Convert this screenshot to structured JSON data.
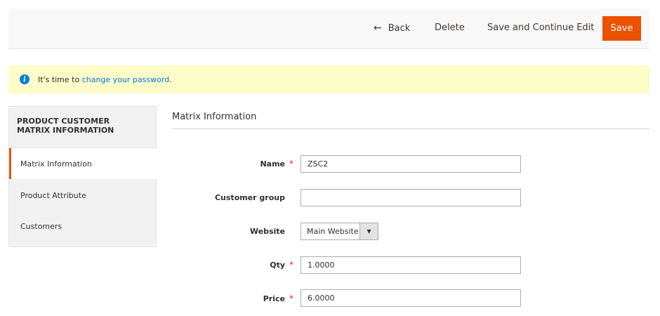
{
  "actions": {
    "back_arrow": "←",
    "back_label": "Back",
    "delete_label": "Delete",
    "save_continue_label": "Save and Continue Edit",
    "save_label": "Save"
  },
  "notice": {
    "icon": "info-icon",
    "text_before": "It's time to ",
    "link_text": "change your password",
    "text_after": "."
  },
  "sidebar": {
    "title": "PRODUCT CUSTOMER MATRIX INFORMATION",
    "items": [
      {
        "label": "Matrix Information",
        "active": true
      },
      {
        "label": "Product Attribute",
        "active": false
      },
      {
        "label": "Customers",
        "active": false
      }
    ]
  },
  "main": {
    "section_title": "Matrix Information",
    "fields": {
      "name": {
        "label": "Name",
        "value": "ZSC2",
        "required": true
      },
      "customer_group": {
        "label": "Customer group",
        "value": "",
        "required": false
      },
      "website": {
        "label": "Website",
        "value": "Main Website",
        "required": false
      },
      "qty": {
        "label": "Qty",
        "value": "1.0000",
        "required": true
      },
      "price": {
        "label": "Price",
        "value": "6.0000",
        "required": true
      }
    },
    "required_mark": "*",
    "dropdown_glyph": "▼"
  },
  "colors": {
    "accent": "#eb5202",
    "link": "#007bdb",
    "notice_bg": "#fdfbc8",
    "required": "#e22626"
  }
}
